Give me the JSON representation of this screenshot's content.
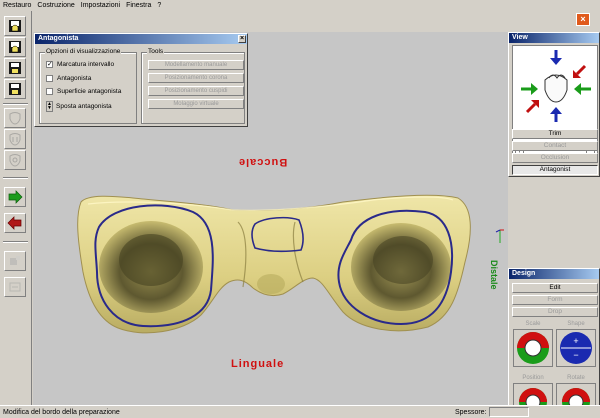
{
  "menu": [
    "Restauro",
    "Costruzione",
    "Impostazioni",
    "Finestra",
    "?"
  ],
  "toolbar": {
    "icons": [
      "save-crown-icon",
      "save-crown-alt-icon",
      "save-disk-icon",
      "save-disk-alt-icon",
      "tooth-a-icon",
      "tooth-b-icon",
      "tooth-c-icon",
      "next-arrow-icon",
      "prev-arrow-icon",
      "tool-a-icon",
      "tool-b-icon"
    ]
  },
  "antagonista": {
    "title": "Antagonista",
    "options_group": "Opzioni di visualizzazione",
    "options": [
      {
        "label": "Marcatura intervallo",
        "checked": true
      },
      {
        "label": "Antagonista",
        "checked": false
      },
      {
        "label": "Superficie antagonista",
        "checked": false
      }
    ],
    "spin_label": "Sposta antagonista",
    "tools_group": "Tools",
    "tools": [
      "Modellamento manuale",
      "Posizionamento corona",
      "Posizionamento cuspidi",
      "Molaggio virtuale"
    ]
  },
  "viewport": {
    "buccal_label": "Buccale",
    "lingual_label": "Linguale",
    "side_label": "Distale"
  },
  "view_panel": {
    "title": "View",
    "buttons": [
      {
        "label": "Trim",
        "enabled": true
      },
      {
        "label": "Contact",
        "enabled": false
      },
      {
        "label": "Occlusion",
        "enabled": false
      },
      {
        "label": "Antagonist",
        "enabled": true,
        "active": true
      }
    ]
  },
  "design_panel": {
    "title": "Design",
    "buttons": [
      {
        "label": "Edit",
        "enabled": true
      },
      {
        "label": "Form",
        "enabled": false
      },
      {
        "label": "Drop",
        "enabled": false
      }
    ],
    "controls": [
      "Scale",
      "Shape",
      "Position",
      "Rotate"
    ]
  },
  "status": {
    "text": "Modifica del bordo della preparazione",
    "spessore_label": "Spessore:",
    "spessore_value": ""
  },
  "colors": {
    "model": "#e8dc8c",
    "margin_line": "#2a2a8a",
    "label_red": "#d01010",
    "title_bar": "#0a246a",
    "viewport_bg": "#c6c6c6"
  }
}
